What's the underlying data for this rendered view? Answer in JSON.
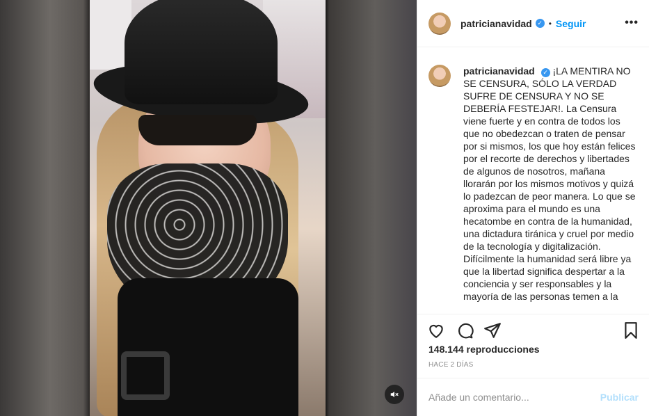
{
  "post": {
    "username": "patricianavidad",
    "follow_label": "Seguir",
    "separator": "•",
    "more_label": "•••",
    "caption": "¡LA MENTIRA NO SE CENSURA, SÓLO LA VERDAD SUFRE DE CENSURA Y NO SE DEBERÍA FESTEJAR!. La Censura viene fuerte y en contra de todos los que no obedezcan o traten de pensar por si mismos, los que hoy están felices por el recorte de derechos y libertades de algunos de nosotros, mañana llorarán por los mismos motivos y quizá lo padezcan de peor manera. Lo que se aproxima para el mundo es una hecatombe en contra de la humanidad, una dictadura tiránica y cruel por medio de la tecnología y digitalización. Difícilmente la humanidad será libre ya que la libertad significa despertar a la conciencia y ser responsables y la mayoría de las personas temen a la",
    "views": "148.144 reproducciones",
    "time_ago": "HACE 2 DÍAS"
  },
  "comment_box": {
    "placeholder": "Añade un comentario...",
    "post_label": "Publicar"
  },
  "icons": {
    "like": "heart-icon",
    "comment": "comment-icon",
    "share": "paper-plane-icon",
    "save": "bookmark-icon",
    "mute": "speaker-muted-icon",
    "verified": "verified-badge-icon"
  },
  "colors": {
    "link_blue": "#0095f6",
    "verified_blue": "#3897f0",
    "muted_text": "#8e8e8e",
    "post_disabled": "#b2dffc"
  }
}
